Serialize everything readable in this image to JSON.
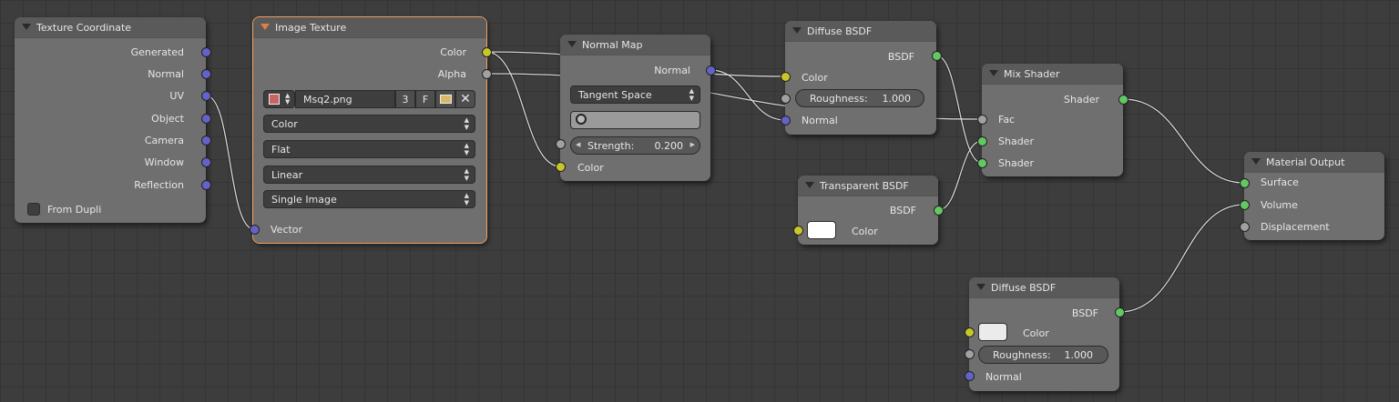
{
  "texture_coordinate": {
    "title": "Texture Coordinate",
    "outputs": [
      "Generated",
      "Normal",
      "UV",
      "Object",
      "Camera",
      "Window",
      "Reflection"
    ],
    "from_dupli": "From Dupli"
  },
  "image_texture": {
    "title": "Image Texture",
    "out_color": "Color",
    "out_alpha": "Alpha",
    "image_name": "Msq2.png",
    "users": "3",
    "fake": "F",
    "color_space": "Color",
    "projection": "Flat",
    "interpolation": "Linear",
    "source": "Single Image",
    "in_vector": "Vector"
  },
  "normal_map": {
    "title": "Normal Map",
    "out_normal": "Normal",
    "space": "Tangent Space",
    "strength_label": "Strength:",
    "strength_value": "0.200",
    "in_color": "Color"
  },
  "diffuse_top": {
    "title": "Diffuse BSDF",
    "out_bsdf": "BSDF",
    "in_color": "Color",
    "roughness_label": "Roughness:",
    "roughness_value": "1.000",
    "in_normal": "Normal"
  },
  "transparent": {
    "title": "Transparent BSDF",
    "out_bsdf": "BSDF",
    "in_color": "Color"
  },
  "mix_shader": {
    "title": "Mix Shader",
    "out_shader": "Shader",
    "in_fac": "Fac",
    "in_shader1": "Shader",
    "in_shader2": "Shader"
  },
  "material_output": {
    "title": "Material Output",
    "in_surface": "Surface",
    "in_volume": "Volume",
    "in_displacement": "Displacement"
  },
  "diffuse_bottom": {
    "title": "Diffuse BSDF",
    "out_bsdf": "BSDF",
    "in_color": "Color",
    "roughness_label": "Roughness:",
    "roughness_value": "1.000",
    "in_normal": "Normal"
  },
  "colors": {
    "vector_socket": "#6363c7",
    "color_socket": "#c7c729",
    "shader_socket": "#63c763",
    "float_socket": "#a1a1a1",
    "active_outline": "#f0a060"
  }
}
